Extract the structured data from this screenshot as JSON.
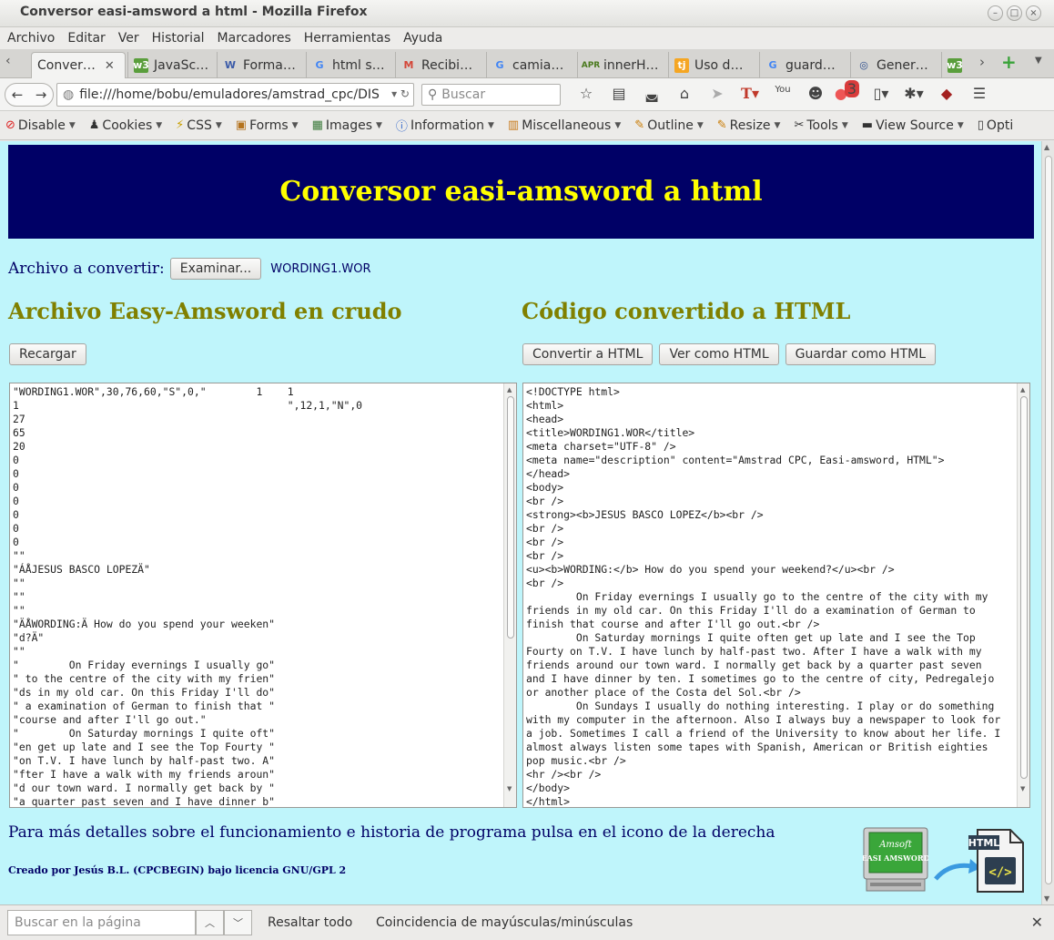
{
  "window": {
    "title": "Conversor easi-amsword a html - Mozilla Firefox"
  },
  "menubar": [
    "Archivo",
    "Editar",
    "Ver",
    "Historial",
    "Marcadores",
    "Herramientas",
    "Ayuda"
  ],
  "tabs": [
    {
      "label": "Conver…",
      "icon": "page-icon",
      "active": true
    },
    {
      "label": "JavaSc…",
      "icon": "w3-icon"
    },
    {
      "label": "Forma…",
      "icon": "w-icon"
    },
    {
      "label": "html s…",
      "icon": "google-icon"
    },
    {
      "label": "Recibi…",
      "icon": "gmail-icon"
    },
    {
      "label": "camia…",
      "icon": "google-icon"
    },
    {
      "label": "innerH…",
      "icon": "apr-icon"
    },
    {
      "label": "Uso d…",
      "icon": "tj-icon"
    },
    {
      "label": "guard…",
      "icon": "google-icon"
    },
    {
      "label": "Gener…",
      "icon": "gen-icon"
    }
  ],
  "nav": {
    "url": "file:///home/bobu/emuladores/amstrad_cpc/DIS",
    "search_placeholder": "Buscar",
    "notification_count": "3"
  },
  "devbar": [
    "Disable",
    "Cookies",
    "CSS",
    "Forms",
    "Images",
    "Information",
    "Miscellaneous",
    "Outline",
    "Resize",
    "Tools",
    "View Source",
    "Opti"
  ],
  "page": {
    "header": "Conversor easi-amsword a html",
    "file_label": "Archivo a convertir:",
    "browse_button": "Examinar...",
    "file_name": "WORDING1.WOR",
    "left_title": "Archivo Easy-Amsword en crudo",
    "right_title": "Código convertido a HTML",
    "reload_button": "Recargar",
    "convert_button": "Convertir a HTML",
    "view_button": "Ver como HTML",
    "save_button": "Guardar como HTML",
    "raw_text": "\"WORDING1.WOR\",30,76,60,\"S\",0,\"        1    1\n1                                           \",12,1,\"N\",0\n27\n65\n20\n0\n0\n0\n0\n0\n0\n0\n\"\"\n\"ÁÅJESUS BASCO LOPEZÄ\"\n\"\"\n\"\"\n\"\"\n\"ÄÅWORDING:Ä How do you spend your weeken\"\n\"d?Ä\"\n\"\"\n\"        On Friday evernings I usually go\"\n\" to the centre of the city with my frien\"\n\"ds in my old car. On this Friday I'll do\"\n\" a examination of German to finish that \"\n\"course and after I'll go out.\"\n\"        On Saturday mornings I quite oft\"\n\"en get up late and I see the Top Fourty \"\n\"on T.V. I have lunch by half-past two. A\"\n\"fter I have a walk with my friends aroun\"\n\"d our town ward. I normally get back by \"\n\"a quarter past seven and I have dinner b\"",
    "html_text": "<!DOCTYPE html>\n<html>\n<head>\n<title>WORDING1.WOR</title>\n<meta charset=\"UTF-8\" />\n<meta name=\"description\" content=\"Amstrad CPC, Easi-amsword, HTML\">\n</head>\n<body>\n<br />\n<strong><b>JESUS BASCO LOPEZ</b><br />\n<br />\n<br />\n<br />\n<u><b>WORDING:</b> How do you spend your weekend?</u><br />\n<br />\n        On Friday evernings I usually go to the centre of the city with my\nfriends in my old car. On this Friday I'll do a examination of German to\nfinish that course and after I'll go out.<br />\n        On Saturday mornings I quite often get up late and I see the Top\nFourty on T.V. I have lunch by half-past two. After I have a walk with my\nfriends around our town ward. I normally get back by a quarter past seven\nand I have dinner by ten. I sometimes go to the centre of city, Pedregalejo\nor another place of the Costa del Sol.<br />\n        On Sundays I usually do nothing interesting. I play or do something\nwith my computer in the afternoon. Also I always buy a newspaper to look for\na job. Sometimes I call a friend of the University to know about her life. I\nalmost always listen some tapes with Spanish, American or British eighties\npop music.<br />\n<hr /><br />\n</body>\n</html>",
    "footnote": "Para más detalles sobre el funcionamiento e historia de programa pulsa en el icono de la derecha",
    "credit": "Creado por Jesús B.L. (CPCBEGIN) bajo licencia GNU/GPL 2",
    "amsword_icon_lines": [
      "Amsoft",
      "EASI AMSWORD"
    ],
    "html_icon_label": "HTML"
  },
  "findbar": {
    "placeholder": "Buscar en la página",
    "highlight_all": "Resaltar todo",
    "match_case": "Coincidencia de mayúsculas/minúsculas"
  },
  "colors": {
    "page_bg": "#bff5fb",
    "banner_bg": "#000066",
    "banner_text": "#ffff00",
    "heading": "#808000"
  }
}
